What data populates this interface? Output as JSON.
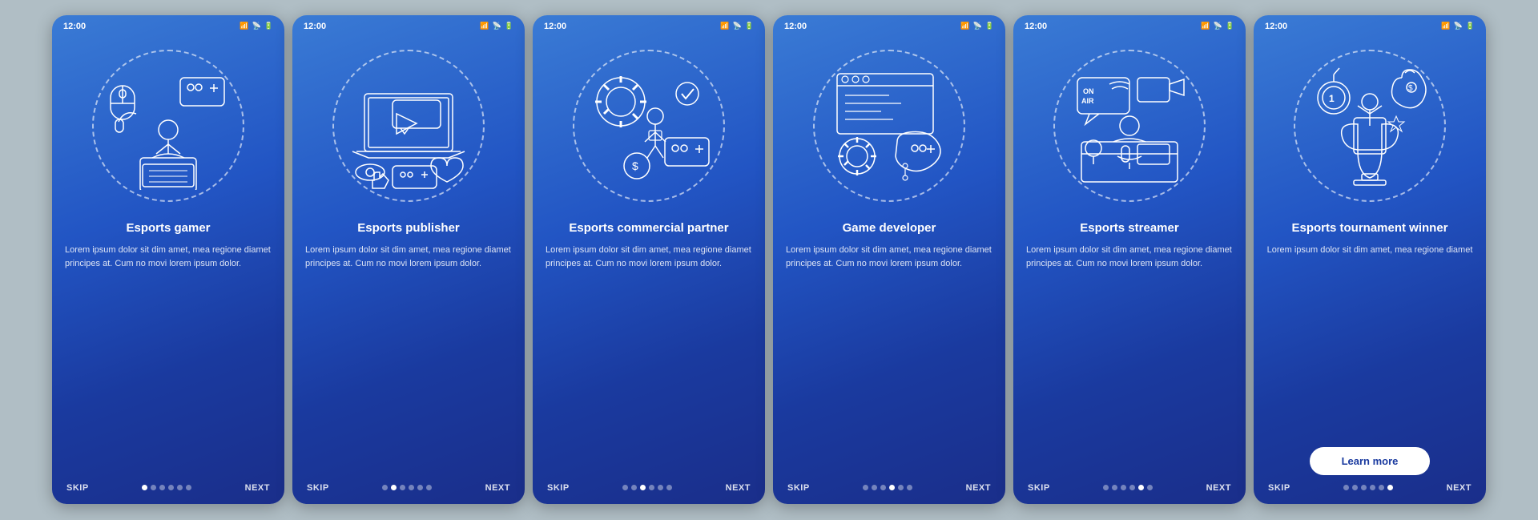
{
  "background_color": "#b0bec5",
  "cards": [
    {
      "id": "esports-gamer",
      "time": "12:00",
      "title": "Esports gamer",
      "body": "Lorem ipsum dolor sit dim amet, mea regione diamet principes at. Cum no movi lorem ipsum dolor.",
      "skip_label": "SKIP",
      "next_label": "NEXT",
      "active_dot": 0,
      "dots_count": 6,
      "has_learn_more": false
    },
    {
      "id": "esports-publisher",
      "time": "12:00",
      "title": "Esports publisher",
      "body": "Lorem ipsum dolor sit dim amet, mea regione diamet principes at. Cum no movi lorem ipsum dolor.",
      "skip_label": "SKIP",
      "next_label": "NEXT",
      "active_dot": 1,
      "dots_count": 6,
      "has_learn_more": false
    },
    {
      "id": "esports-commercial",
      "time": "12:00",
      "title": "Esports commercial partner",
      "body": "Lorem ipsum dolor sit dim amet, mea regione diamet principes at. Cum no movi lorem ipsum dolor.",
      "skip_label": "SKIP",
      "next_label": "NEXT",
      "active_dot": 2,
      "dots_count": 6,
      "has_learn_more": false
    },
    {
      "id": "game-developer",
      "time": "12:00",
      "title": "Game developer",
      "body": "Lorem ipsum dolor sit dim amet, mea regione diamet principes at. Cum no movi lorem ipsum dolor.",
      "skip_label": "SKIP",
      "next_label": "NEXT",
      "active_dot": 3,
      "dots_count": 6,
      "has_learn_more": false
    },
    {
      "id": "esports-streamer",
      "time": "12:00",
      "title": "Esports streamer",
      "body": "Lorem ipsum dolor sit dim amet, mea regione diamet principes at. Cum no movi lorem ipsum dolor.",
      "skip_label": "SKIP",
      "next_label": "NEXT",
      "active_dot": 4,
      "dots_count": 6,
      "has_learn_more": false
    },
    {
      "id": "esports-tournament",
      "time": "12:00",
      "title": "Esports tournament winner",
      "body": "Lorem ipsum dolor sit dim amet, mea regione diamet",
      "skip_label": "SKIP",
      "next_label": "NEXT",
      "active_dot": 5,
      "dots_count": 6,
      "has_learn_more": true,
      "learn_more_label": "Learn more"
    }
  ]
}
